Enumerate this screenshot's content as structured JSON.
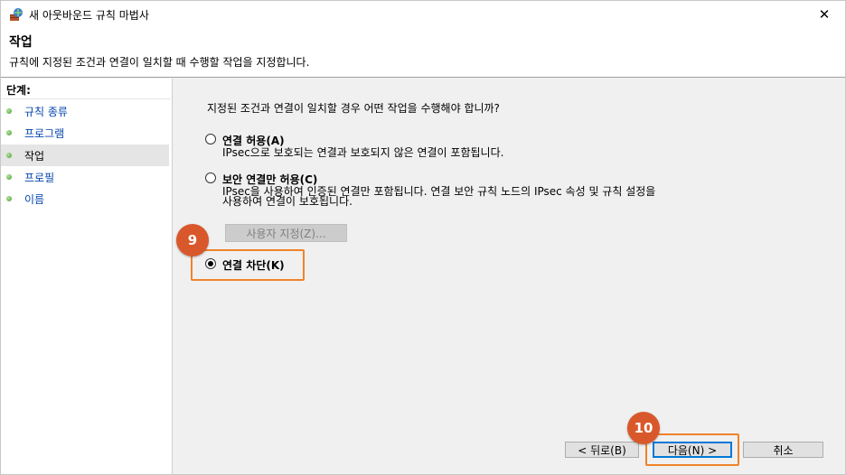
{
  "window": {
    "title": "새 아웃바운드 규칙 마법사",
    "close_glyph": "✕"
  },
  "header": {
    "title": "작업",
    "description": "규칙에 지정된 조건과 연결이 일치할 때 수행할 작업을 지정합니다."
  },
  "steps": {
    "title": "단계:",
    "items": [
      {
        "label": "규칙 종류",
        "active": false
      },
      {
        "label": "프로그램",
        "active": false
      },
      {
        "label": "작업",
        "active": true
      },
      {
        "label": "프로필",
        "active": false
      },
      {
        "label": "이름",
        "active": false
      }
    ]
  },
  "main": {
    "question": "지정된 조건과 연결이 일치할 경우 어떤 작업을 수행해야 합니까?",
    "options": [
      {
        "label": "연결 허용(A)",
        "description_lines": [
          "IPsec으로 보호되는 연결과 보호되지 않은 연결이 포함됩니다."
        ],
        "checked": false
      },
      {
        "label": "보안 연결만 허용(C)",
        "description_lines": [
          "IPsec을 사용하여 인증된 연결만 포함됩니다. 연결 보안 규칙 노드의 IPsec 속성 및 규칙 설정을",
          "사용하여 연결이 보호됩니다."
        ],
        "checked": false
      },
      {
        "label": "연결 차단(K)",
        "description_lines": [],
        "checked": true
      }
    ],
    "customize_button": "사용자 지정(Z)..."
  },
  "annotations": {
    "badge_block": "9",
    "badge_next": "10",
    "accent_color": "#f0832a",
    "badge_color": "#d9582b"
  },
  "footer": {
    "back_button": "< 뒤로(B)",
    "next_button": "다음(N) >",
    "cancel_button": "취소"
  }
}
